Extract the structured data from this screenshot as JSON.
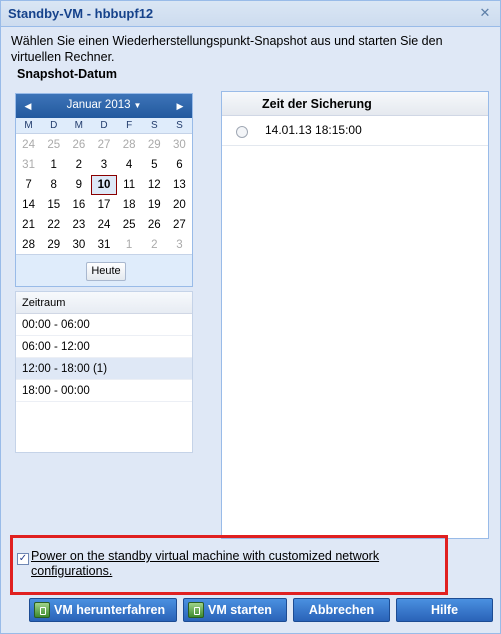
{
  "window": {
    "title": "Standby-VM - hbbupf12"
  },
  "intro": "Wählen Sie einen Wiederherstellungspunkt-Snapshot aus und starten Sie den virtuellen Rechner.",
  "section_label": "Snapshot-Datum",
  "calendar": {
    "month_label": "Januar 2013",
    "weekdays": [
      "M",
      "D",
      "M",
      "D",
      "F",
      "S",
      "S"
    ],
    "today_button": "Heute",
    "selected_day": "10",
    "weeks": [
      [
        "24",
        "25",
        "26",
        "27",
        "28",
        "29",
        "30"
      ],
      [
        "31",
        "1",
        "2",
        "3",
        "4",
        "5",
        "6"
      ],
      [
        "7",
        "8",
        "9",
        "10",
        "11",
        "12",
        "13"
      ],
      [
        "14",
        "15",
        "16",
        "17",
        "18",
        "19",
        "20"
      ],
      [
        "21",
        "22",
        "23",
        "24",
        "25",
        "26",
        "27"
      ],
      [
        "28",
        "29",
        "30",
        "31",
        "1",
        "2",
        "3"
      ]
    ]
  },
  "ranges": {
    "header": "Zeitraum",
    "items": [
      "00:00 - 06:00",
      "06:00 - 12:00",
      "12:00 - 18:00 (1)",
      "18:00 - 00:00"
    ],
    "selected_index": 2
  },
  "times": {
    "header": "Zeit der Sicherung",
    "rows": [
      "14.01.13 18:15:00"
    ]
  },
  "network_option": {
    "checked": true,
    "label": "Power on the standby virtual machine with customized network configurations."
  },
  "buttons": {
    "shutdown": "VM herunterfahren",
    "start": "VM starten",
    "cancel": "Abbrechen",
    "help": "Hilfe"
  },
  "colors": {
    "accent": "#2a63b8",
    "highlight_border": "#e02020",
    "title_text": "#15428b"
  }
}
